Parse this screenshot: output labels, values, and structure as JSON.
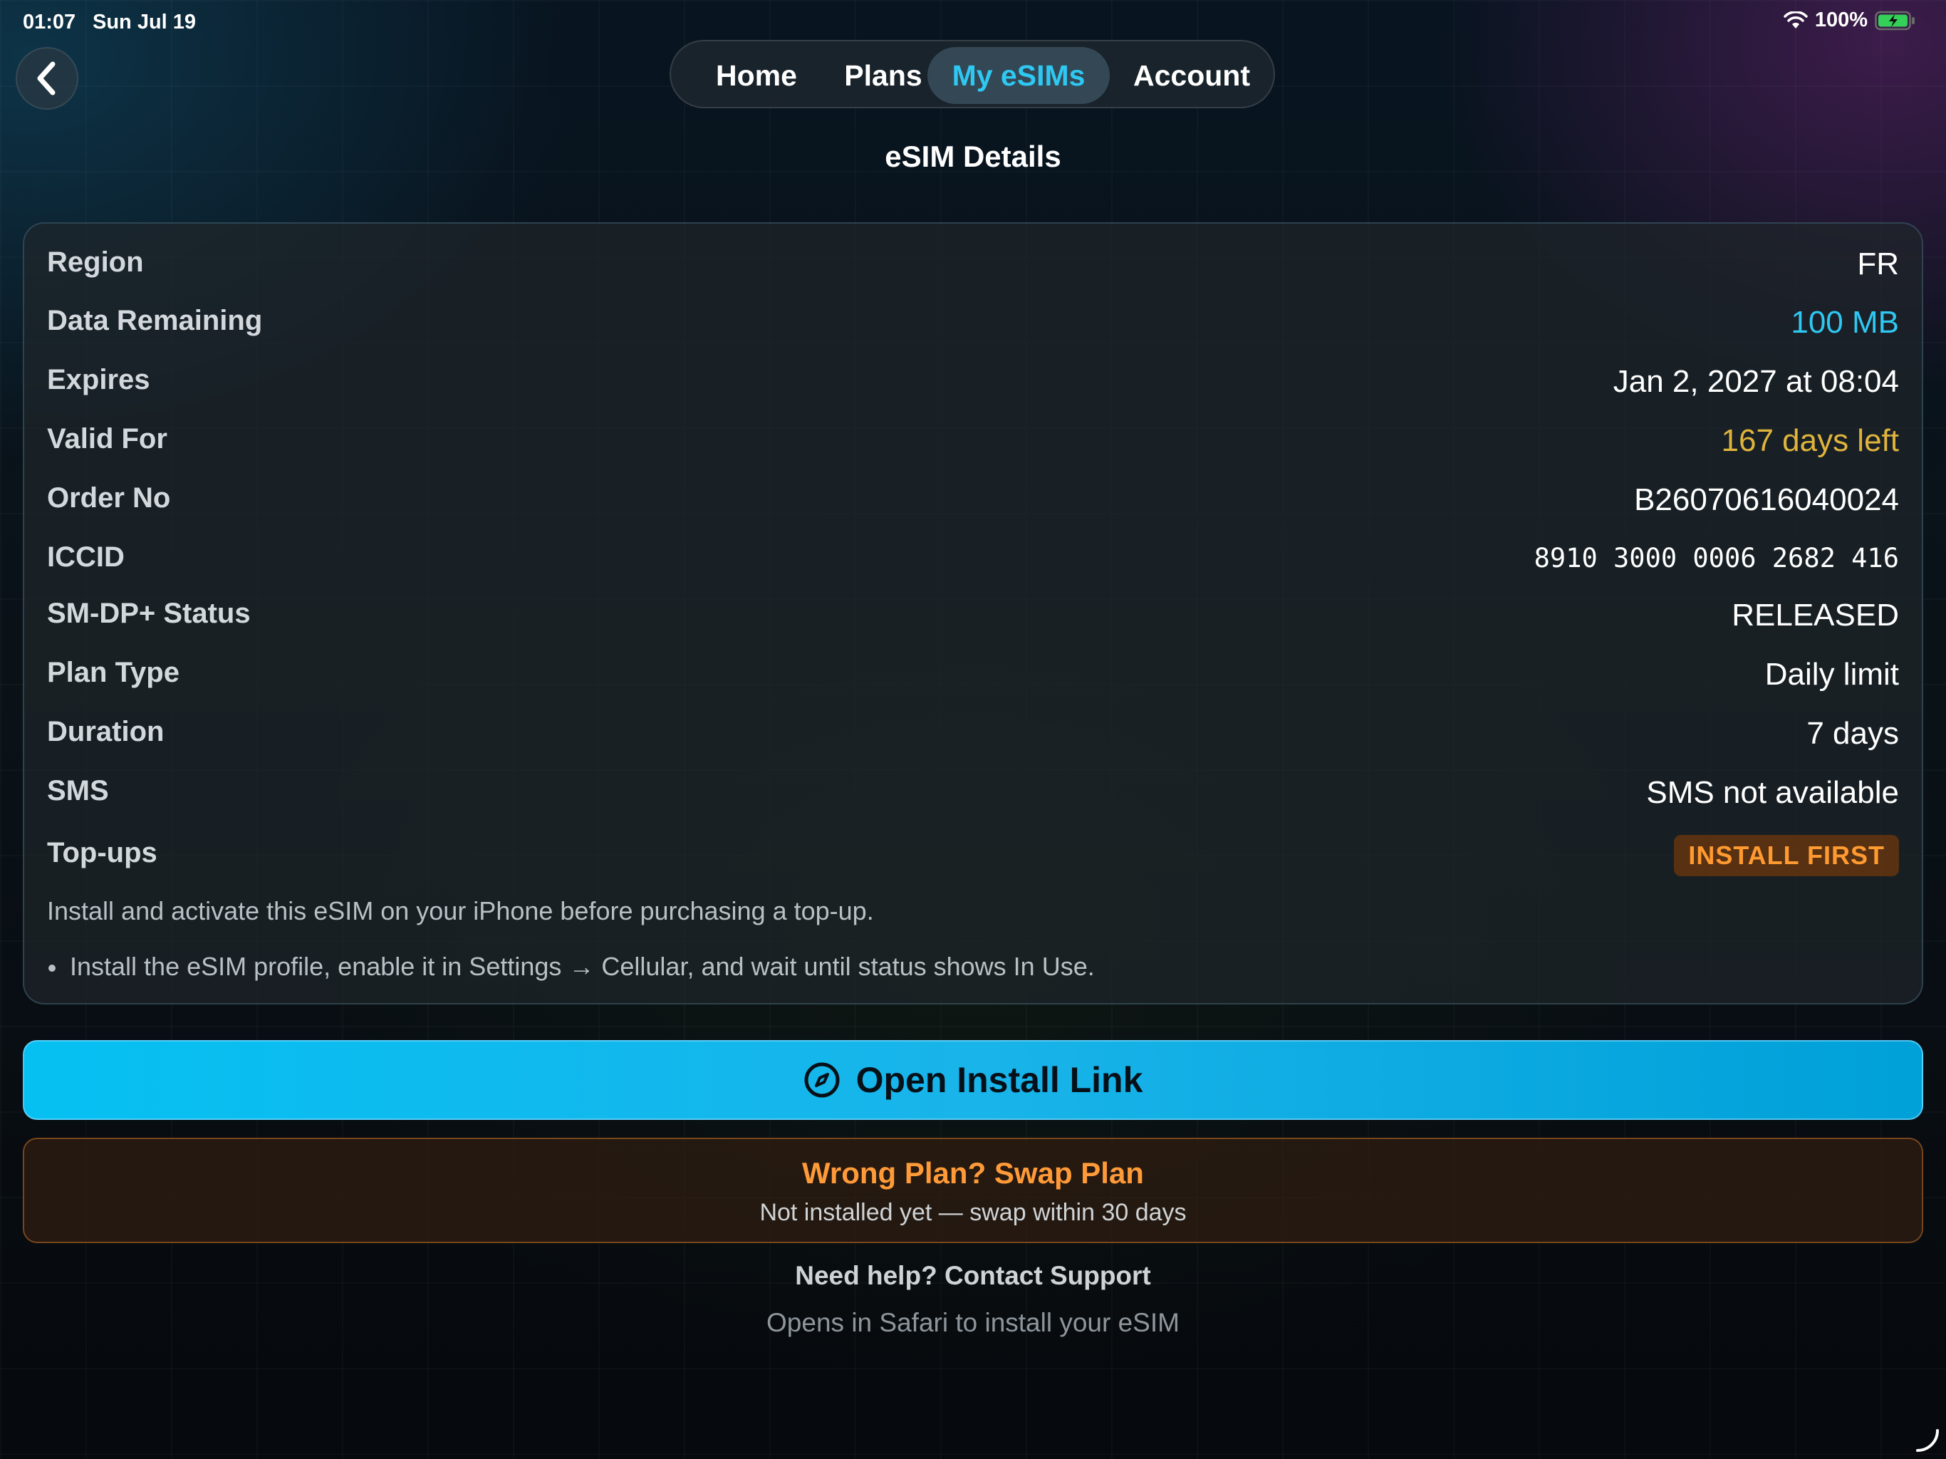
{
  "status_bar": {
    "time": "01:07",
    "date": "Sun Jul 19",
    "battery": "100%",
    "icons": [
      "wifi-icon",
      "battery-charging-icon"
    ]
  },
  "header": {
    "back_icon": "chevron-left-icon",
    "tabs": [
      {
        "label": "Home",
        "active": false
      },
      {
        "label": "Plans",
        "active": false
      },
      {
        "label": "My eSIMs",
        "active": true
      },
      {
        "label": "Account",
        "active": false
      }
    ],
    "title": "eSIM Details"
  },
  "details": {
    "rows": [
      {
        "label": "Region",
        "value": "FR"
      },
      {
        "label": "Data Remaining",
        "value": "100 MB"
      },
      {
        "label": "Expires",
        "value": "Jan 2, 2027 at 08:04"
      },
      {
        "label": "Valid For",
        "value": "167 days left"
      },
      {
        "label": "Order No",
        "value": "B26070616040024"
      },
      {
        "label": "ICCID",
        "value": "8910 3000 0006 2682 416"
      },
      {
        "label": "SM-DP+ Status",
        "value": "RELEASED"
      },
      {
        "label": "Plan Type",
        "value": "Daily limit"
      },
      {
        "label": "Duration",
        "value": "7 days"
      },
      {
        "label": "SMS",
        "value": "SMS not available"
      },
      {
        "label": "Top-ups",
        "badge": "INSTALL FIRST"
      }
    ],
    "note": "Install and activate this eSIM on your iPhone before purchasing a top-up.",
    "bullet": "Install the eSIM profile, enable it in Settings → Cellular, and wait until status shows In Use."
  },
  "actions": {
    "install_label": "Open Install Link",
    "install_icon": "compass-icon",
    "swap_title": "Wrong Plan? Swap Plan",
    "swap_subtitle": "Not installed yet — swap within 30 days",
    "help_label": "Need help? Contact Support",
    "safari_note": "Opens in Safari to install your eSIM"
  },
  "colors": {
    "accent_blue": "#2ec8f2",
    "valid_gold": "#e0b43c",
    "warning_orange": "#ff9a30",
    "install_button": "#06c0f2"
  }
}
